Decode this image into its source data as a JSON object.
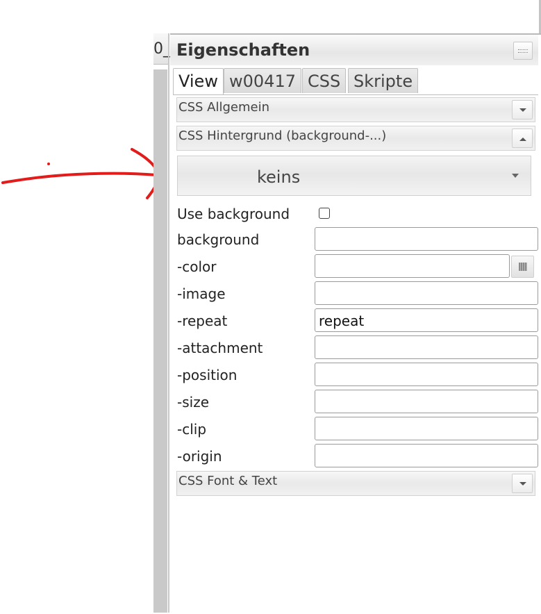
{
  "left_panel": {
    "title_fragment": "0_"
  },
  "panel": {
    "title": "Eigenschaften",
    "tabs": [
      {
        "label": "View",
        "active": true
      },
      {
        "label": "w00417"
      },
      {
        "label": "CSS"
      },
      {
        "label": "Skripte"
      }
    ],
    "sections": {
      "css_general": {
        "label": "CSS Allgemein",
        "expanded": false
      },
      "css_background": {
        "label": "CSS Hintergrund (background-...)",
        "expanded": true
      },
      "css_font": {
        "label": "CSS Font & Text",
        "expanded": false
      }
    },
    "background_preset": {
      "selected": "keins"
    },
    "fields": {
      "use_background": {
        "label": "Use background",
        "checked": false
      },
      "background": {
        "label": "background",
        "value": ""
      },
      "color": {
        "label": "-color",
        "value": ""
      },
      "image": {
        "label": "-image",
        "value": ""
      },
      "repeat": {
        "label": "-repeat",
        "value": "repeat"
      },
      "attachment": {
        "label": "-attachment",
        "value": ""
      },
      "position": {
        "label": "-position",
        "value": ""
      },
      "size": {
        "label": "-size",
        "value": ""
      },
      "clip": {
        "label": "-clip",
        "value": ""
      },
      "origin": {
        "label": "-origin",
        "value": ""
      }
    }
  },
  "annotation": {
    "color": "#e21b1b",
    "shape": "arrow"
  }
}
